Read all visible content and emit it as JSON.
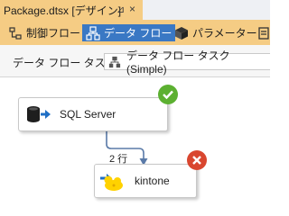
{
  "tab": {
    "title": "Package.dtsx [デザイン]",
    "pin": "⊿",
    "close": "×"
  },
  "toolbar": {
    "control_flow": "制御フロー",
    "data_flow": "データ フロー",
    "parameters": "パラメーター"
  },
  "task": {
    "label": "データ フロー タスク:",
    "selected": "データ フロー タスク(Simple)"
  },
  "components": {
    "source": {
      "label": "SQL Server",
      "status": "success"
    },
    "destination": {
      "label": "kintone",
      "status": "error"
    }
  },
  "path": {
    "rows": "2 行"
  },
  "colors": {
    "accent": "#f5cc84",
    "active": "#3a78c4",
    "success": "#5cb031",
    "error": "#d9462f"
  }
}
